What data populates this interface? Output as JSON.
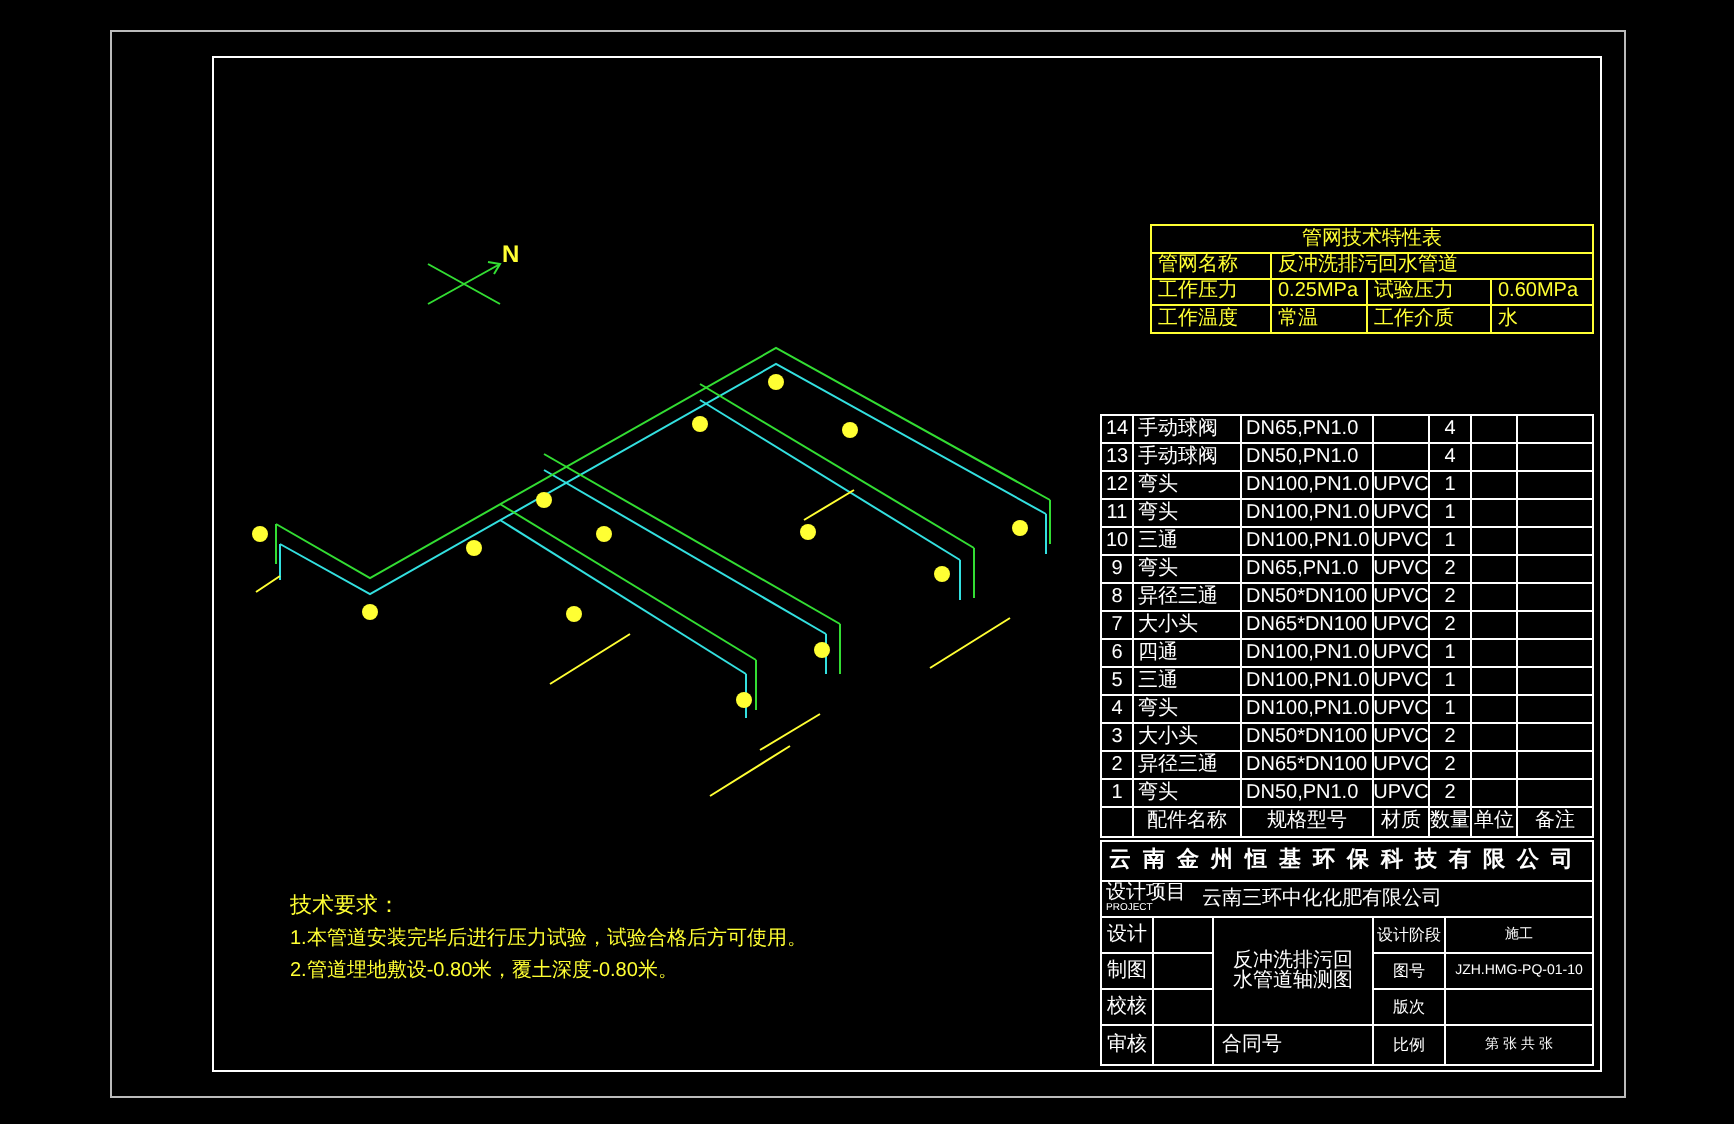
{
  "north_label": "N",
  "spec_table": {
    "title": "管网技术特性表",
    "rows": [
      [
        "管网名称",
        "反冲洗排污回水管道"
      ],
      [
        "工作压力",
        "0.25MPa",
        "试验压力",
        "0.60MPa"
      ],
      [
        "工作温度",
        "常温",
        "工作介质",
        "水"
      ]
    ]
  },
  "parts": [
    {
      "no": "14",
      "name": "手动球阀",
      "spec": "DN65,PN1.0",
      "qty": "4"
    },
    {
      "no": "13",
      "name": "手动球阀",
      "spec": "DN50,PN1.0",
      "qty": "4"
    },
    {
      "no": "12",
      "name": "弯头",
      "spec": "DN100,PN1.0",
      "material": "UPVC",
      "qty": "1"
    },
    {
      "no": "11",
      "name": "弯头",
      "spec": "DN100,PN1.0",
      "material": "UPVC",
      "qty": "1"
    },
    {
      "no": "10",
      "name": "三通",
      "spec": "DN100,PN1.0",
      "material": "UPVC",
      "qty": "1"
    },
    {
      "no": "9",
      "name": "弯头",
      "spec": "DN65,PN1.0",
      "material": "UPVC",
      "qty": "2"
    },
    {
      "no": "8",
      "name": "异径三通",
      "spec": "DN50*DN100",
      "material": "UPVC",
      "qty": "2"
    },
    {
      "no": "7",
      "name": "大小头",
      "spec": "DN65*DN100",
      "material": "UPVC",
      "qty": "2"
    },
    {
      "no": "6",
      "name": "四通",
      "spec": "DN100,PN1.0",
      "material": "UPVC",
      "qty": "1"
    },
    {
      "no": "5",
      "name": "三通",
      "spec": "DN100,PN1.0",
      "material": "UPVC",
      "qty": "1"
    },
    {
      "no": "4",
      "name": "弯头",
      "spec": "DN100,PN1.0",
      "material": "UPVC",
      "qty": "1"
    },
    {
      "no": "3",
      "name": "大小头",
      "spec": "DN50*DN100",
      "material": "UPVC",
      "qty": "2"
    },
    {
      "no": "2",
      "name": "异径三通",
      "spec": "DN65*DN100",
      "material": "UPVC",
      "qty": "2"
    },
    {
      "no": "1",
      "name": "弯头",
      "spec": "DN50,PN1.0",
      "material": "UPVC",
      "qty": "2"
    }
  ],
  "parts_header": [
    "配件名称",
    "规格型号",
    "材质",
    "数量",
    "单位",
    "备注"
  ],
  "title_block": {
    "company": "云南金州恒基环保科技有限公司",
    "project_label": "设计项目",
    "project_label_en": "PROJECT",
    "project": "云南三环中化化肥有限公司",
    "left_labels": [
      "设计",
      "制图",
      "校核",
      "审核"
    ],
    "drawing_title": "反冲洗排污回水管道轴测图",
    "contract_label": "合同号",
    "right_labels": [
      "设计阶段",
      "图号",
      "版次",
      "比例"
    ],
    "stage": "施工",
    "drawing_no": "JZH.HMG-PQ-01-10",
    "sheet": "第 张 共 张"
  },
  "notes": {
    "title": "技术要求：",
    "items": [
      "1.本管道安装完毕后进行压力试验，试验合格后方可使用。",
      "2.管道埋地敷设-0.80米，覆土深度-0.80米。"
    ]
  }
}
